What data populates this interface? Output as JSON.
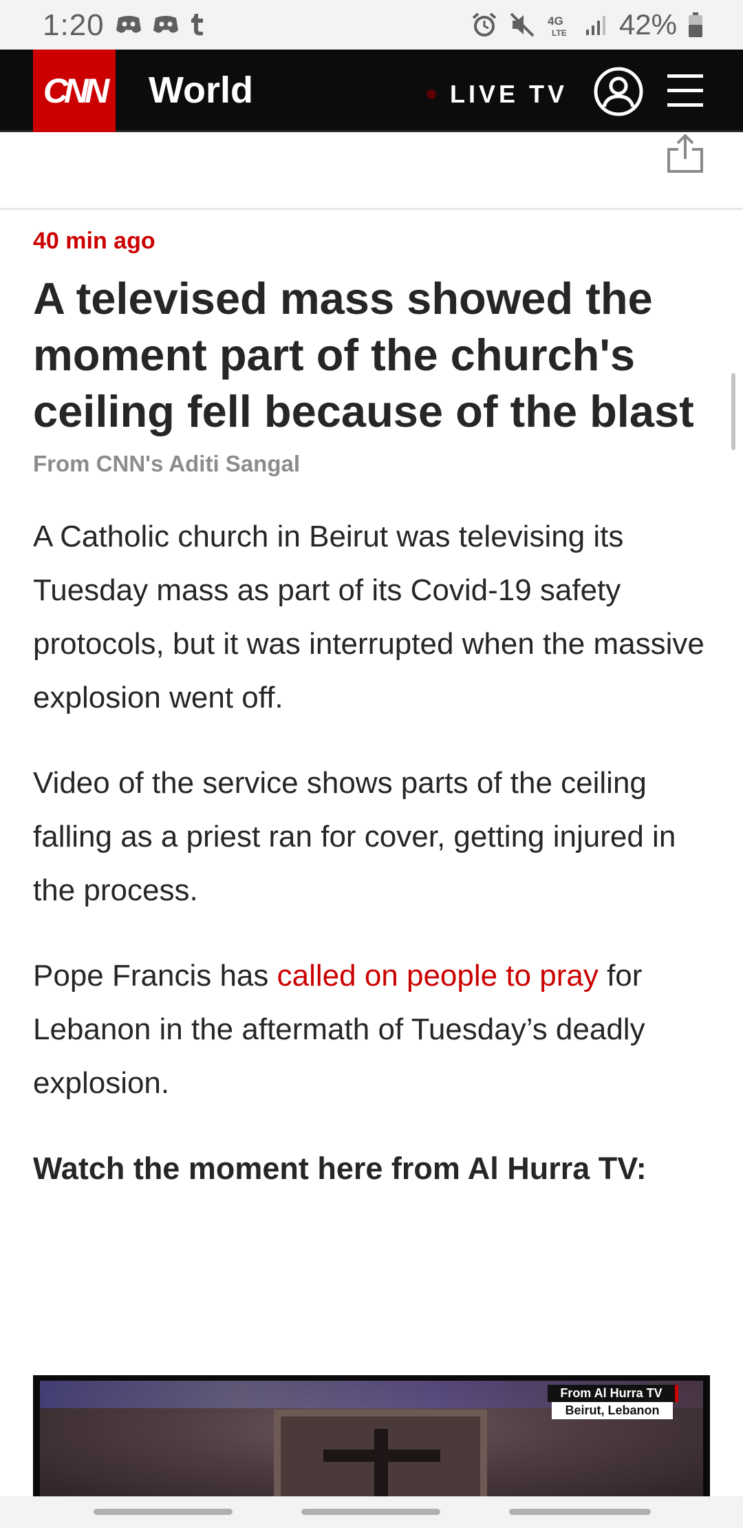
{
  "status_bar": {
    "time": "1:20",
    "left_icons": [
      "discord-icon",
      "discord-icon",
      "tumblr-icon"
    ],
    "right_icons": [
      "alarm-icon",
      "mute-icon",
      "lte-icon",
      "signal-icon",
      "battery-icon"
    ],
    "network_label": "4G LTE",
    "battery": "42%"
  },
  "header": {
    "logo": "CNN",
    "section": "World",
    "live_label": "LIVE TV",
    "user_icon": "user-icon",
    "menu_icon": "menu-icon"
  },
  "share": {
    "icon": "share-icon"
  },
  "article": {
    "timestamp": "40 min ago",
    "headline": "A televised mass showed the moment part of the church's ceiling fell because of the blast",
    "byline": "From CNN's Aditi Sangal",
    "paragraphs": [
      "A Catholic church in Beirut was televising its Tuesday mass as part of its Covid-19 safety protocols, but it was interrupted when the massive explosion went off.",
      "Video of the service shows parts of the ceiling falling as a priest ran for cover, getting injured in the process."
    ],
    "para3": {
      "before": "Pope Francis has ",
      "link": "called on people to pray",
      "after": " for Lebanon in the aftermath of Tuesday’s deadly explosion."
    },
    "subhead": "Watch the moment here from Al Hurra TV:"
  },
  "video": {
    "overlay_line1": "From Al Hurra TV",
    "overlay_line2": "Beirut, Lebanon"
  },
  "colors": {
    "accent": "#cc0000",
    "header_bg": "#0c0c0c",
    "text": "#262626",
    "byline": "#8c8c8c"
  }
}
